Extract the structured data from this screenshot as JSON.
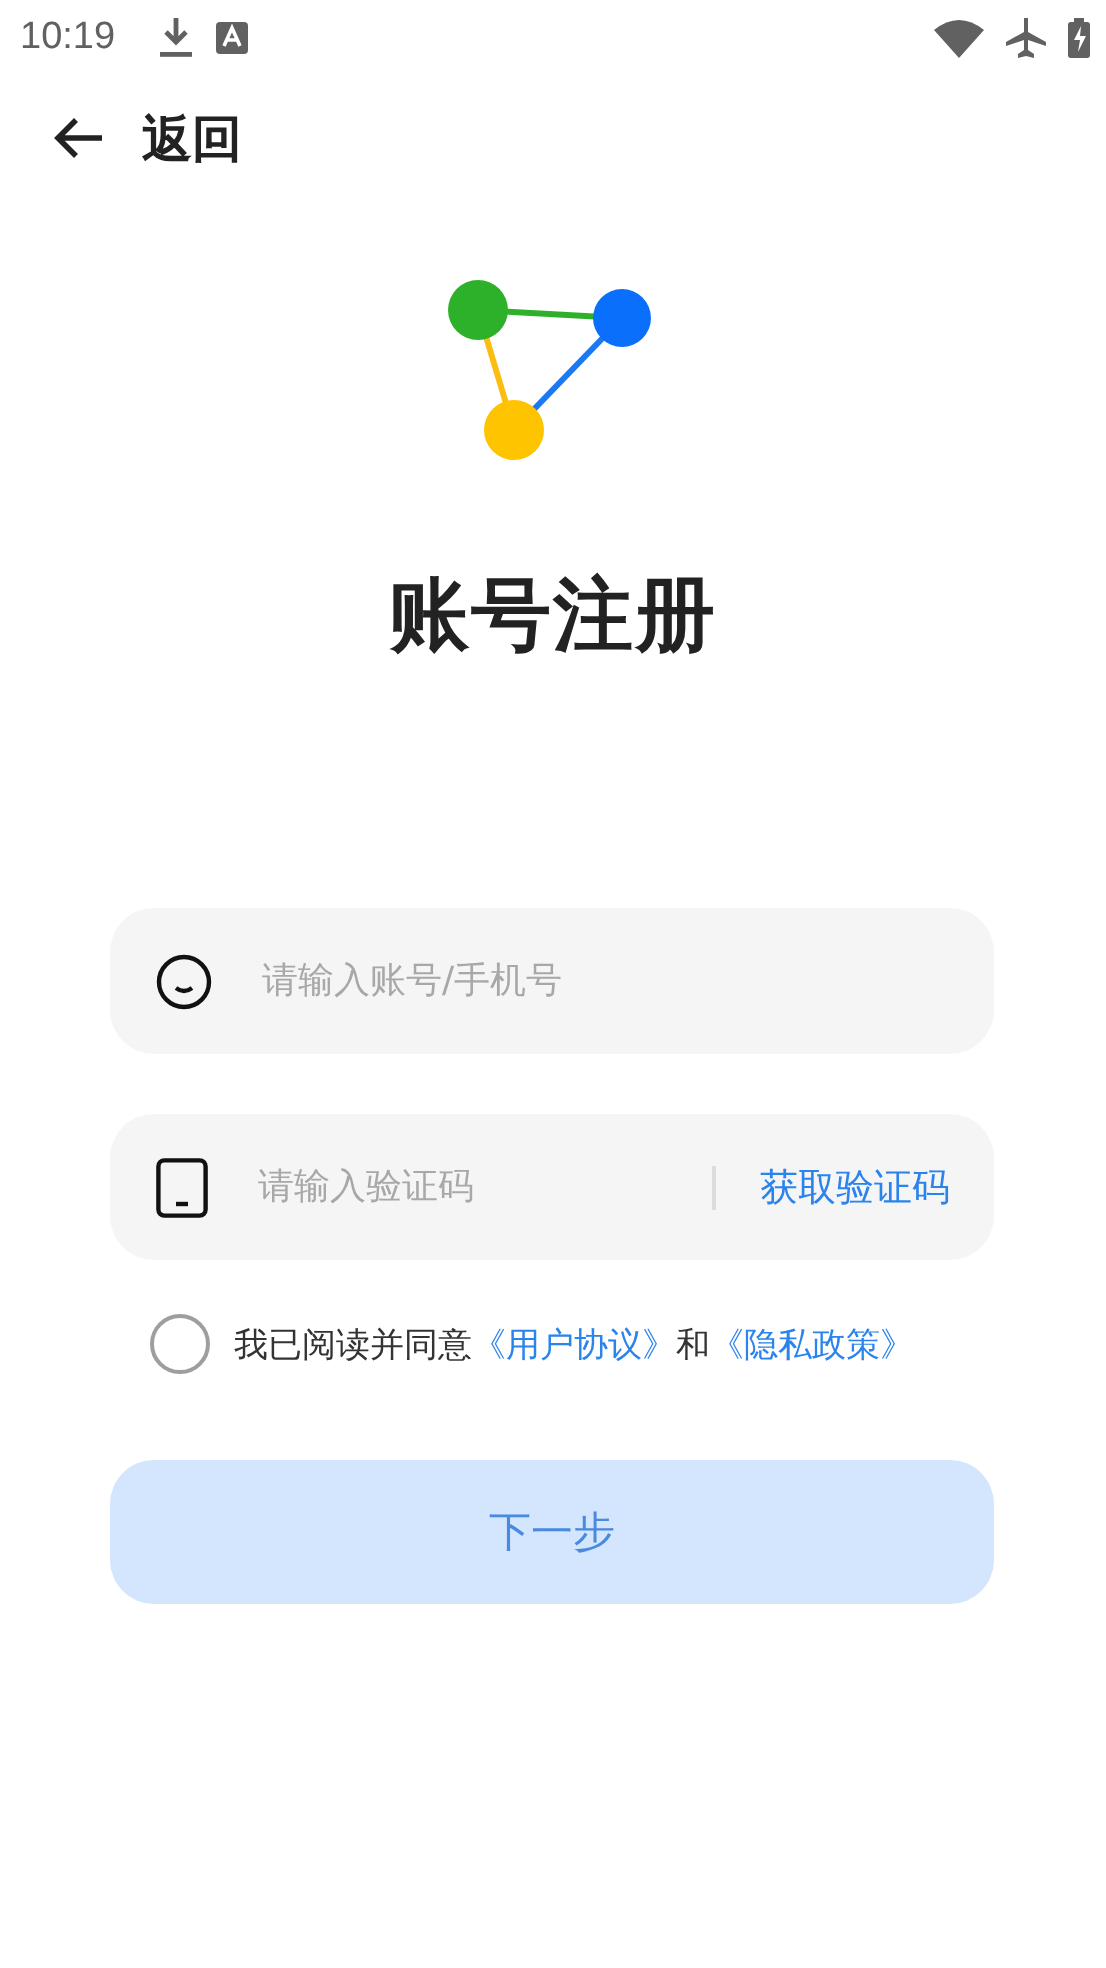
{
  "status_bar": {
    "time": "10:19"
  },
  "nav": {
    "back_label": "返回"
  },
  "title": "账号注册",
  "fields": [
    {
      "kind": "account",
      "placeholder": "请输入账号/手机号"
    },
    {
      "kind": "code",
      "placeholder": "请输入验证码",
      "action": "获取验证码"
    }
  ],
  "agreement": {
    "checked": false,
    "parts": [
      {
        "kind": "text",
        "text": "我已阅读并同意"
      },
      {
        "kind": "link",
        "text": "《用户协议》"
      },
      {
        "kind": "text",
        "text": "和"
      },
      {
        "kind": "link",
        "text": "《隐私政策》"
      }
    ]
  },
  "next_button": {
    "label": "下一步",
    "disabled": true
  }
}
